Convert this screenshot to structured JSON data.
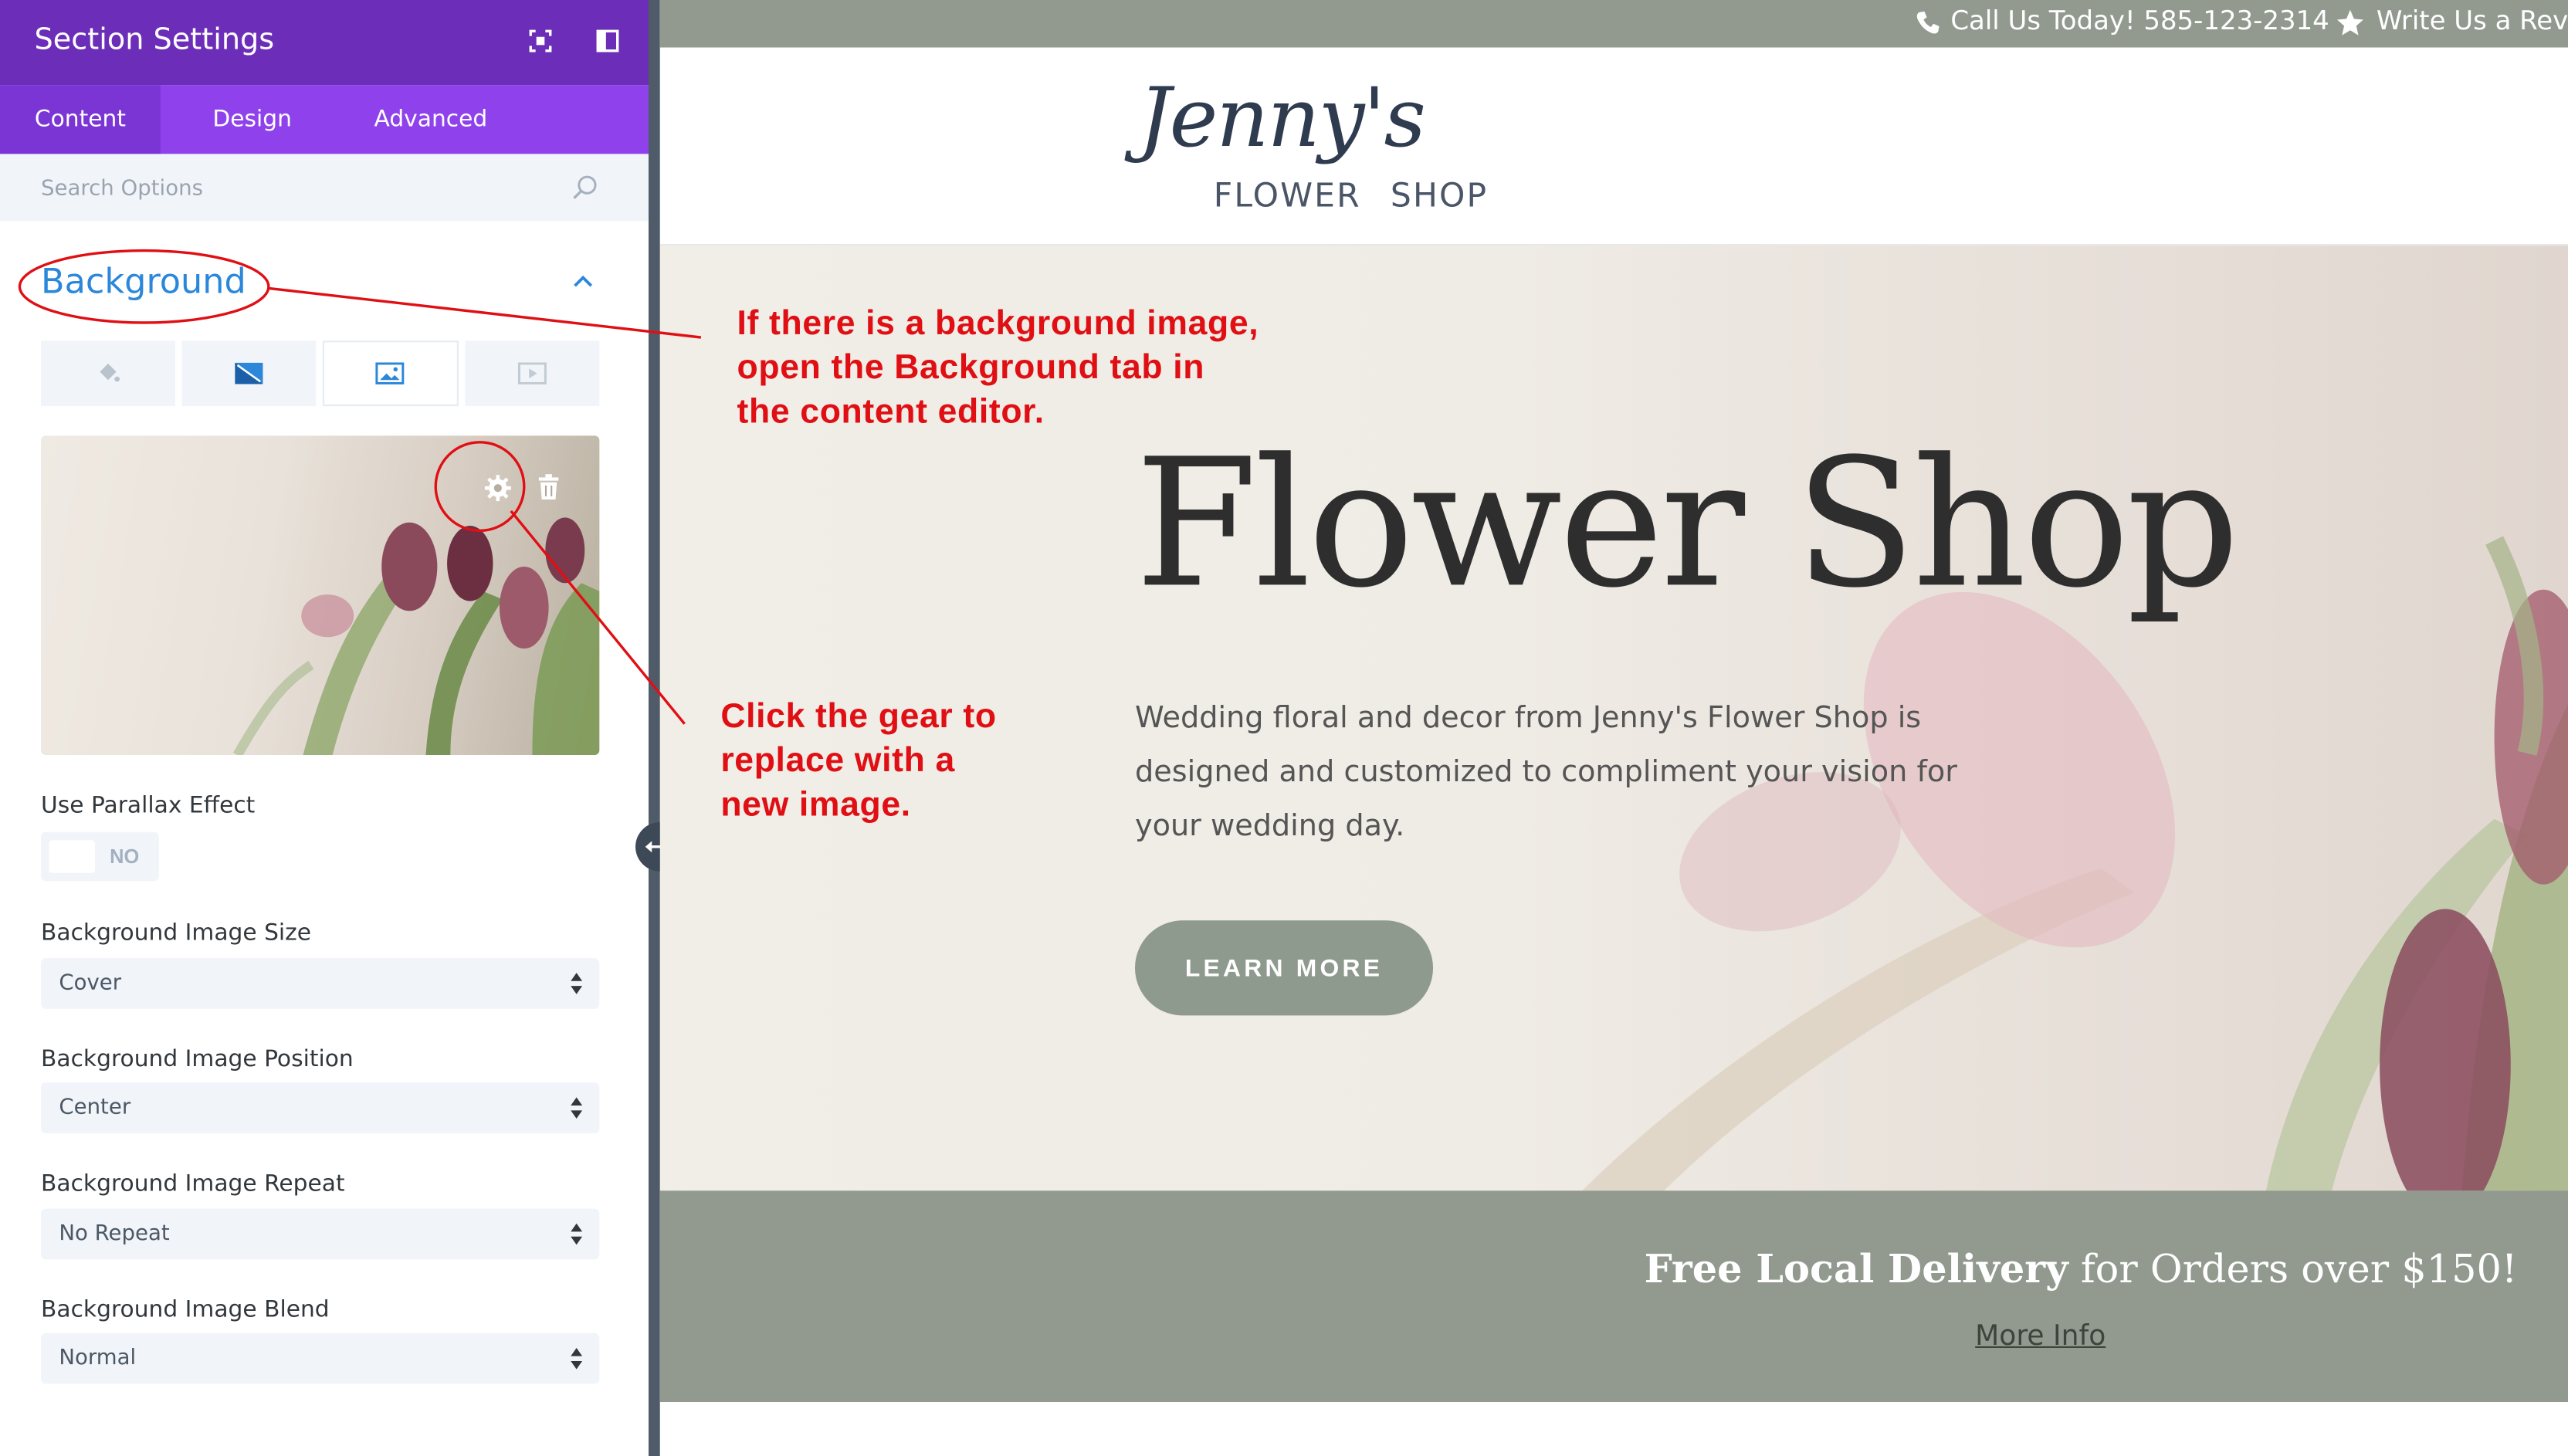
{
  "panel": {
    "title": "Section Settings",
    "header_icons": [
      "focus-icon",
      "sidebar-layout-icon"
    ],
    "tabs": [
      {
        "label": "Content",
        "active": true
      },
      {
        "label": "Design",
        "active": false
      },
      {
        "label": "Advanced",
        "active": false
      }
    ],
    "search_placeholder": "Search Options",
    "section": {
      "title": "Background",
      "expanded": true
    },
    "background_tabs": [
      {
        "icon": "paint-bucket-icon",
        "active": false
      },
      {
        "icon": "gradient-icon",
        "active": false
      },
      {
        "icon": "image-icon",
        "active": true
      },
      {
        "icon": "video-icon",
        "active": false
      }
    ],
    "fields": {
      "parallax": {
        "label": "Use Parallax Effect",
        "value": "NO"
      },
      "size": {
        "label": "Background Image Size",
        "value": "Cover"
      },
      "position": {
        "label": "Background Image Position",
        "value": "Center"
      },
      "repeat": {
        "label": "Background Image Repeat",
        "value": "No Repeat"
      },
      "blend": {
        "label": "Background Image Blend",
        "value": "Normal"
      }
    }
  },
  "site": {
    "topbar": {
      "phone": "Call Us Today! 585-123-2314",
      "review": "Write Us a Revi"
    },
    "logo": {
      "script": "Jenny's",
      "sub_left": "FLOWER",
      "sub_right": "SHOP"
    },
    "hero": {
      "title": "Flower Shop",
      "text": "Wedding floral and decor from Jenny's Flower Shop is designed and customized to compliment your vision for your wedding day.",
      "button": "LEARN MORE"
    },
    "promo": {
      "bold": "Free Local Delivery",
      "rest": " for Orders over $150!",
      "link": "More Info"
    }
  },
  "annotations": {
    "background_note": "If there is a background image,\nopen the Background tab in\nthe content editor.",
    "gear_note": "Click the gear to\nreplace with a\nnew image."
  },
  "colors": {
    "panel_header": "#6c2eb9",
    "panel_tabs": "#8f42ec",
    "accent_blue": "#2b87da",
    "annotation_red": "#e00f14",
    "site_band": "#929a90"
  }
}
